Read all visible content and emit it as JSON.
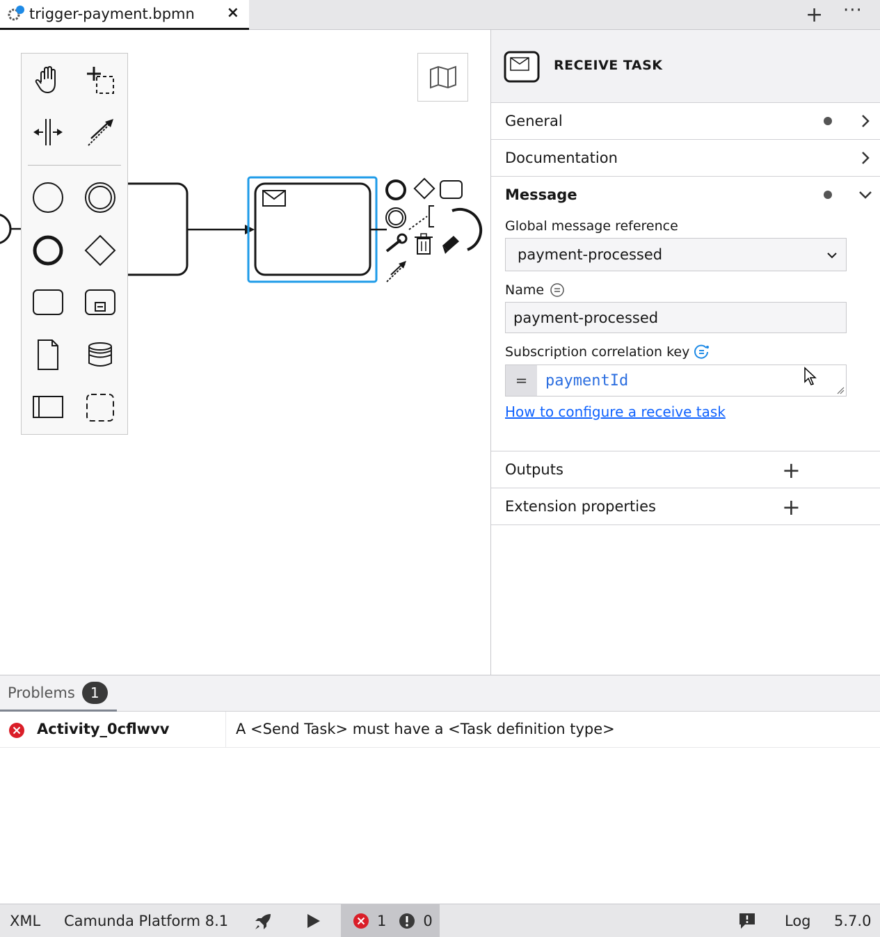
{
  "tab": {
    "title": "trigger-payment.bpmn",
    "close": "×"
  },
  "tabbar": {
    "add": "+",
    "more": "···"
  },
  "panel": {
    "header_title": "RECEIVE TASK",
    "groups": {
      "general": "General",
      "documentation": "Documentation",
      "message": "Message",
      "outputs": "Outputs",
      "extension_properties": "Extension properties"
    },
    "message": {
      "global_ref_label": "Global message reference",
      "global_ref_value": "payment-processed",
      "name_label": "Name",
      "name_value": "payment-processed",
      "correlation_label": "Subscription correlation key",
      "correlation_eq": "=",
      "correlation_value": "paymentId",
      "help_link": "How to configure a receive task"
    }
  },
  "problems": {
    "tab_label": "Problems",
    "count": "1",
    "rows": [
      {
        "id": "Activity_0cflwvv",
        "message": "A <Send Task> must have a <Task definition type>"
      }
    ]
  },
  "statusbar": {
    "xml": "XML",
    "platform": "Camunda Platform 8.1",
    "errors": "1",
    "warnings": "0",
    "log": "Log",
    "version": "5.7.0"
  },
  "colors": {
    "selection": "#1e9be8",
    "link": "#0f62fe",
    "error": "#da1e28",
    "code": "#2b6ee0"
  }
}
